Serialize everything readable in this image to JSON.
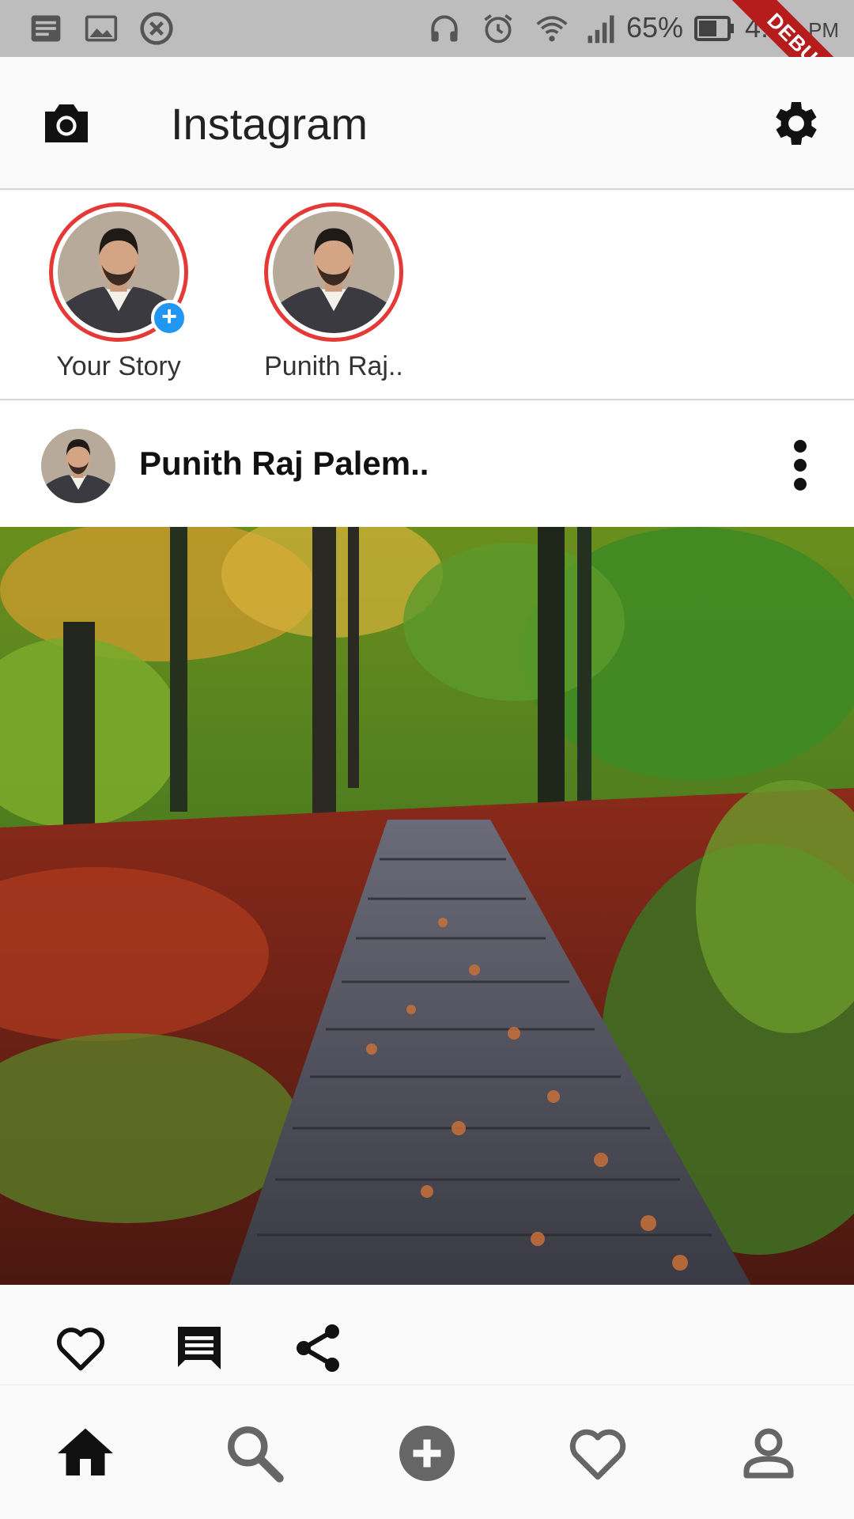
{
  "status_bar": {
    "battery": "65%",
    "time": "4:31",
    "ampm": "PM",
    "debug_label": "DEBUG",
    "icons": [
      "notification-icon",
      "image-icon",
      "blocked-icon",
      "headphones-icon",
      "alarm-icon",
      "wifi-icon",
      "signal-icon",
      "battery-icon"
    ]
  },
  "app_bar": {
    "title": "Instagram",
    "left_icon": "camera-icon",
    "right_icon": "settings-icon"
  },
  "stories": [
    {
      "label": "Your Story",
      "has_add_badge": true
    },
    {
      "label": "Punith Raj.."
    }
  ],
  "post": {
    "username": "Punith Raj Palem..",
    "actions": [
      "like-icon",
      "comment-icon",
      "share-icon"
    ]
  },
  "bottom_nav": {
    "items": [
      "home-icon",
      "search-icon",
      "add-icon",
      "activity-icon",
      "profile-icon"
    ],
    "active": "home-icon"
  },
  "colors": {
    "story_ring": "#e53935",
    "add_badge": "#2196f3",
    "status_bar": "#bdbdbd",
    "debug_ribbon": "#b71c1c"
  }
}
